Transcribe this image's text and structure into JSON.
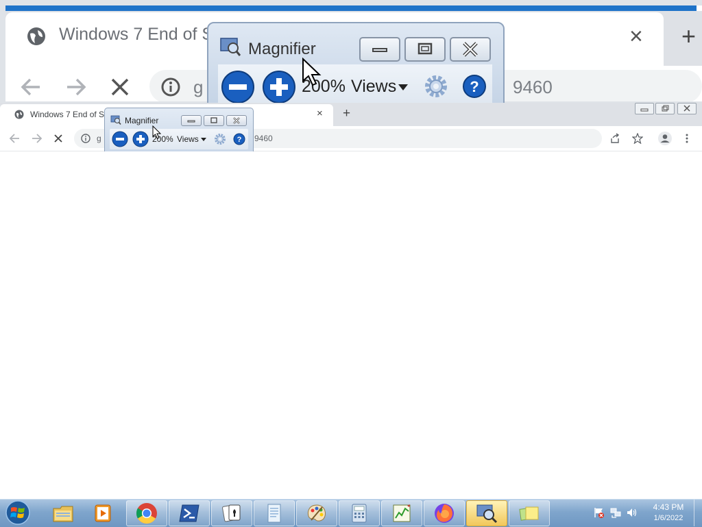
{
  "magnified_view": {
    "tab_title": "Windows 7 End of Su",
    "tab_close": "×",
    "new_tab": "+",
    "url_head": "g",
    "url_tail": "9460",
    "magnifier": {
      "title": "Magnifier",
      "zoom": "200%",
      "views": "Views"
    }
  },
  "browser": {
    "tab": {
      "title": "Windows 7 End of S",
      "close": "×"
    },
    "new_tab": "+",
    "url_head": "g",
    "url_tail": "9460"
  },
  "magnifier": {
    "title": "Magnifier",
    "zoom": "200%",
    "views": "Views"
  },
  "taskbar": {
    "items": [
      {
        "name": "explorer",
        "icon": "folder-icon"
      },
      {
        "name": "media",
        "icon": "media-player-icon"
      },
      {
        "name": "chrome",
        "icon": "chrome-icon"
      },
      {
        "name": "powershell",
        "icon": "powershell-icon"
      },
      {
        "name": "solitaire",
        "icon": "cards-icon"
      },
      {
        "name": "notepad",
        "icon": "document-icon"
      },
      {
        "name": "paint",
        "icon": "palette-icon"
      },
      {
        "name": "calculator",
        "icon": "calculator-icon"
      },
      {
        "name": "monitor",
        "icon": "chart-icon"
      },
      {
        "name": "firefox",
        "icon": "firefox-icon"
      },
      {
        "name": "magnifier",
        "icon": "magnifier-icon"
      },
      {
        "name": "sticky",
        "icon": "sticky-notes-icon"
      }
    ],
    "time": "4:43 PM",
    "date": "1/6/2022"
  },
  "colors": {
    "accent": "#1e73c9",
    "taskbar": "#7fa5cc",
    "magnifier_blue": "#1a5fbf"
  }
}
